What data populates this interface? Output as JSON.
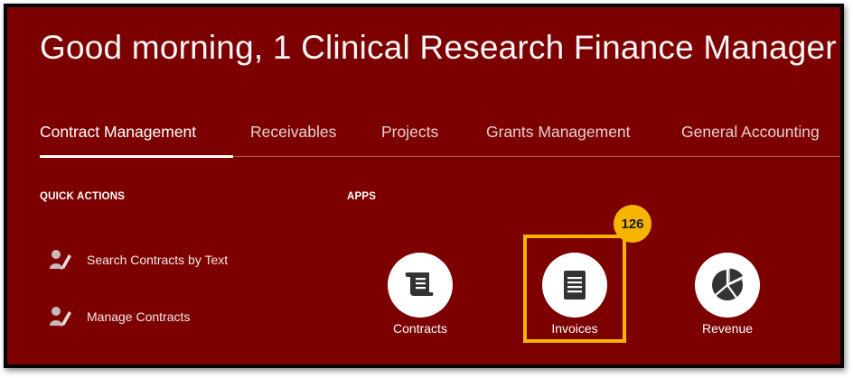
{
  "header": {
    "greeting": "Good morning, 1 Clinical Research Finance Manager"
  },
  "tabs": [
    {
      "label": "Contract Management",
      "active": true
    },
    {
      "label": "Receivables",
      "active": false
    },
    {
      "label": "Projects",
      "active": false
    },
    {
      "label": "Grants Management",
      "active": false
    },
    {
      "label": "General Accounting",
      "active": false
    }
  ],
  "quick_actions": {
    "title": "QUICK ACTIONS",
    "items": [
      {
        "label": "Search Contracts by Text",
        "icon": "person-edit-icon"
      },
      {
        "label": "Manage Contracts",
        "icon": "person-edit-icon"
      }
    ]
  },
  "apps": {
    "title": "APPS",
    "items": [
      {
        "label": "Contracts",
        "icon": "scroll-icon"
      },
      {
        "label": "Invoices",
        "icon": "document-lines-icon"
      },
      {
        "label": "Revenue",
        "icon": "pie-chart-icon"
      }
    ]
  },
  "annotation": {
    "badge": "126",
    "color": "#f4b400"
  },
  "colors": {
    "background": "#7d0000",
    "text": "#ffffff"
  }
}
